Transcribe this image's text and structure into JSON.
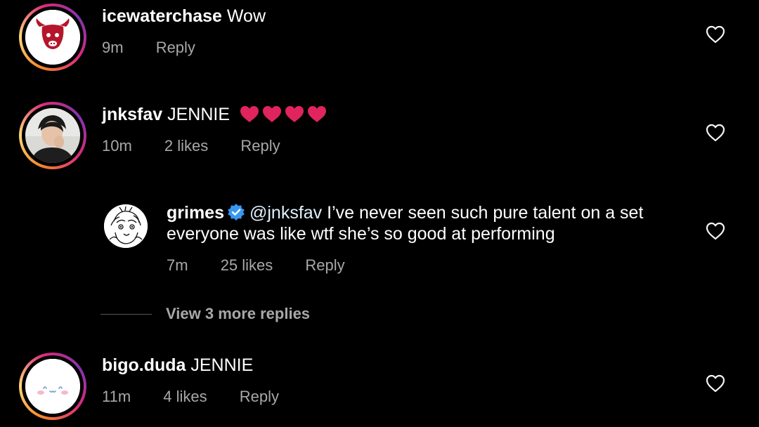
{
  "comments": [
    {
      "username": "icewaterchase",
      "text": "Wow",
      "time": "9m",
      "likes": "",
      "reply_label": "Reply"
    },
    {
      "username": "jnksfav",
      "text": "JENNIE",
      "emoji": "❤️❤️❤️❤️",
      "time": "10m",
      "likes": "2 likes",
      "reply_label": "Reply"
    },
    {
      "username": "bigo.duda",
      "text": "JENNIE",
      "time": "11m",
      "likes": "4 likes",
      "reply_label": "Reply"
    }
  ],
  "reply": {
    "username": "grimes",
    "mention": "@jnksfav",
    "text": "I’ve never seen such pure talent on a set everyone was like wtf she’s so good at performing",
    "time": "7m",
    "likes": "25 likes",
    "reply_label": "Reply"
  },
  "view_more_label": "View 3 more replies",
  "colors": {
    "background": "#000000",
    "text": "#ffffff",
    "meta": "#a8a8a8",
    "verified": "#3897f0",
    "heart_emoji": "#e0245e"
  },
  "icons": [
    "bull-avatar",
    "profile-photo-avatar",
    "anime-sketch-avatar",
    "cinnamoroll-avatar",
    "heart-outline-icon",
    "verified-badge-icon"
  ]
}
